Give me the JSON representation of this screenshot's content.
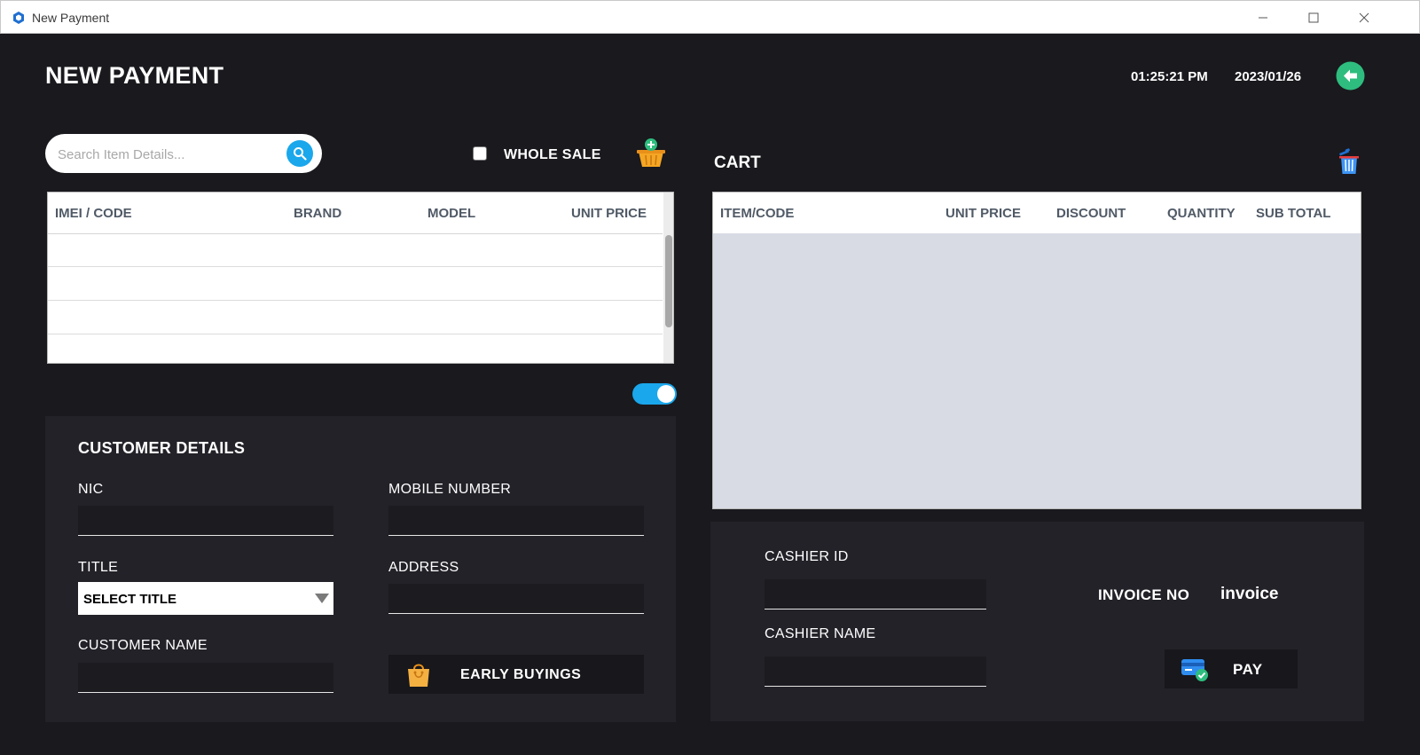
{
  "window": {
    "title": "New Payment",
    "icon": "app-logo-icon",
    "controls": [
      "minimize-icon",
      "maximize-icon",
      "close-icon"
    ]
  },
  "header": {
    "title": "NEW PAYMENT",
    "time": "01:25:21 PM",
    "date": "2023/01/26",
    "back_icon": "arrow-left-circle-icon"
  },
  "search": {
    "placeholder": "Search Item Details...",
    "value": "",
    "icon": "search-icon"
  },
  "wholesale": {
    "label": "WHOLE SALE",
    "checked": false
  },
  "items_table": {
    "columns": [
      "IMEI / CODE",
      "BRAND",
      "MODEL",
      "UNIT PRICE"
    ],
    "rows": []
  },
  "toggle": {
    "on": true
  },
  "customer": {
    "title": "CUSTOMER DETAILS",
    "nic_label": "NIC",
    "mobile_label": "MOBILE NUMBER",
    "title_label": "TITLE",
    "title_select": "SELECT TITLE",
    "address_label": "ADDRESS",
    "name_label": "CUSTOMER NAME",
    "early_buyings_label": "EARLY BUYINGS"
  },
  "cart": {
    "title": "CART",
    "columns": [
      "ITEM/CODE",
      "UNIT PRICE",
      "DISCOUNT",
      "QUANTITY",
      "SUB TOTAL"
    ],
    "rows": []
  },
  "payment": {
    "cashier_id_label": "CASHIER ID",
    "cashier_name_label": "CASHIER NAME",
    "invoice_label": "INVOICE NO",
    "invoice_value": "invoice",
    "pay_label": "PAY"
  },
  "colors": {
    "background": "#19191e",
    "panel": "#222228",
    "accent_blue": "#1aa7ec",
    "back_green": "#2ebd7e",
    "basket_orange": "#f5a623"
  }
}
